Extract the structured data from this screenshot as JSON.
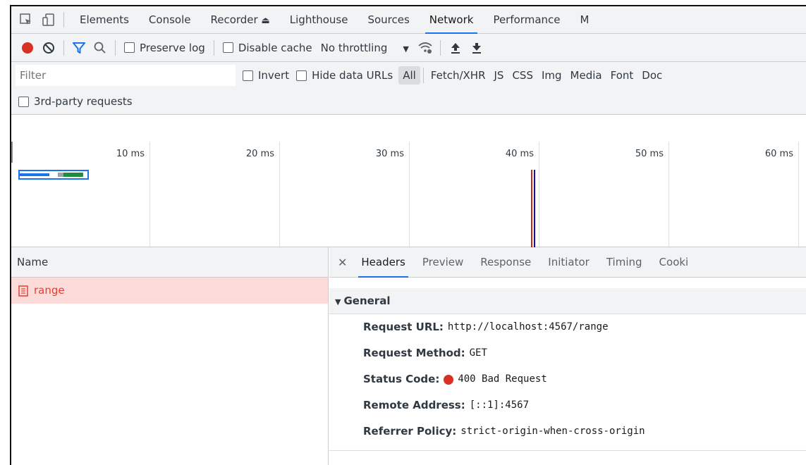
{
  "tabs": [
    "Elements",
    "Console",
    "Recorder",
    "Lighthouse",
    "Sources",
    "Network",
    "Performance",
    "M"
  ],
  "toolbar": {
    "preserve_log": "Preserve log",
    "disable_cache": "Disable cache",
    "throttling": "No throttling"
  },
  "filter": {
    "placeholder": "Filter",
    "invert": "Invert",
    "hide_data_urls": "Hide data URLs",
    "types": [
      "All",
      "Fetch/XHR",
      "JS",
      "CSS",
      "Img",
      "Media",
      "Font",
      "Doc"
    ],
    "third_party": "3rd-party requests"
  },
  "overview": {
    "ticks": [
      "10 ms",
      "20 ms",
      "30 ms",
      "40 ms",
      "50 ms",
      "60 ms"
    ]
  },
  "requests": {
    "header": "Name",
    "items": [
      {
        "name": "range"
      }
    ]
  },
  "detail": {
    "tabs": [
      "Headers",
      "Preview",
      "Response",
      "Initiator",
      "Timing",
      "Cooki"
    ],
    "section_title": "General",
    "fields": [
      {
        "key": "Request URL:",
        "value": "http://localhost:4567/range"
      },
      {
        "key": "Request Method:",
        "value": "GET"
      },
      {
        "key": "Status Code:",
        "value": "400 Bad Request"
      },
      {
        "key": "Remote Address:",
        "value": "[::1]:4567"
      },
      {
        "key": "Referrer Policy:",
        "value": "strict-origin-when-cross-origin"
      }
    ]
  },
  "colors": {
    "accent": "#1a73e8",
    "record": "#d93025",
    "error_text": "#e53e2f",
    "error_row": "#fcdcdb"
  }
}
